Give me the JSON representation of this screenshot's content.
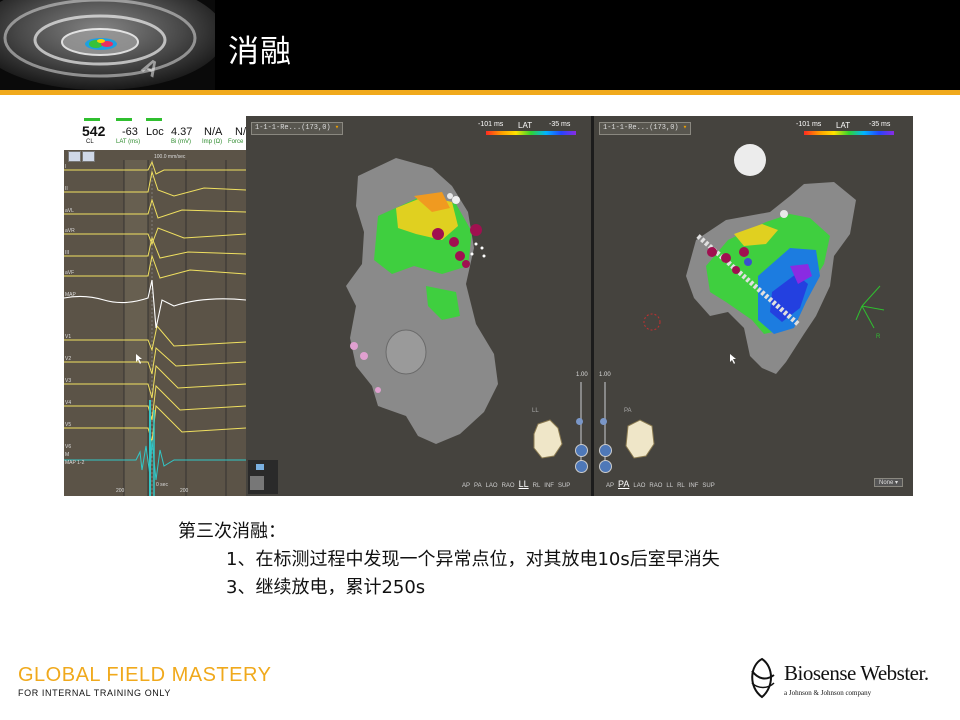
{
  "header": {
    "title": "消融",
    "colors": {
      "background": "#000000",
      "stripe": "#f0a91c"
    }
  },
  "egg": {
    "cl_value": "542",
    "cl_label": "CL",
    "lat_value": "-63",
    "lat_label": "LAT (ms)",
    "loc_value": "Loc",
    "bi_value": "4.37",
    "bi_label": "Bi (mV)",
    "imp_value": "N/A",
    "imp_label": "Imp (Ω)",
    "force_value": "N/",
    "force_label": "Force",
    "sweep_label": "100.0 mm/sec",
    "leads": [
      "I",
      "II",
      "aVL",
      "aVR",
      "III",
      "aVF",
      "MAP",
      "V1",
      "V2",
      "V3",
      "V4",
      "V5",
      "V6",
      "M",
      "MAP 1-2"
    ],
    "time_labels": [
      "200",
      "0 sec",
      "200"
    ]
  },
  "map_left": {
    "dropdown": "1-1-1-Re...(173,0)",
    "lat_min": "-101 ms",
    "lat_title": "LAT",
    "lat_max": "-35 ms",
    "zoom": "1.00",
    "orientation": "LL",
    "views": [
      "AP",
      "PA",
      "LAO",
      "RAO",
      "LL",
      "RL",
      "INF",
      "SUP"
    ],
    "active_view": "LL"
  },
  "map_right": {
    "dropdown": "1-1-1-Re...(173,0)",
    "lat_min": "-101 ms",
    "lat_title": "LAT",
    "lat_max": "-35 ms",
    "zoom": "1.00",
    "orientation": "PA",
    "views": [
      "AP",
      "PA",
      "LAO",
      "RAO",
      "LL",
      "RL",
      "INF",
      "SUP"
    ],
    "active_view": "PA",
    "filter": "None",
    "axis_label": "R"
  },
  "annotation": {
    "heading": "第三次消融：",
    "item1": "1、在标测过程中发现一个异常点位，对其放电10s后室早消失",
    "item2": "3、继续放电，累计250s"
  },
  "footer": {
    "brand": "GLOBAL  FIELD MASTERY",
    "sub": "FOR INTERNAL  TRAINING  ONLY",
    "company": "Biosense Webster.",
    "company_tag": "a Johnson & Johnson company"
  }
}
